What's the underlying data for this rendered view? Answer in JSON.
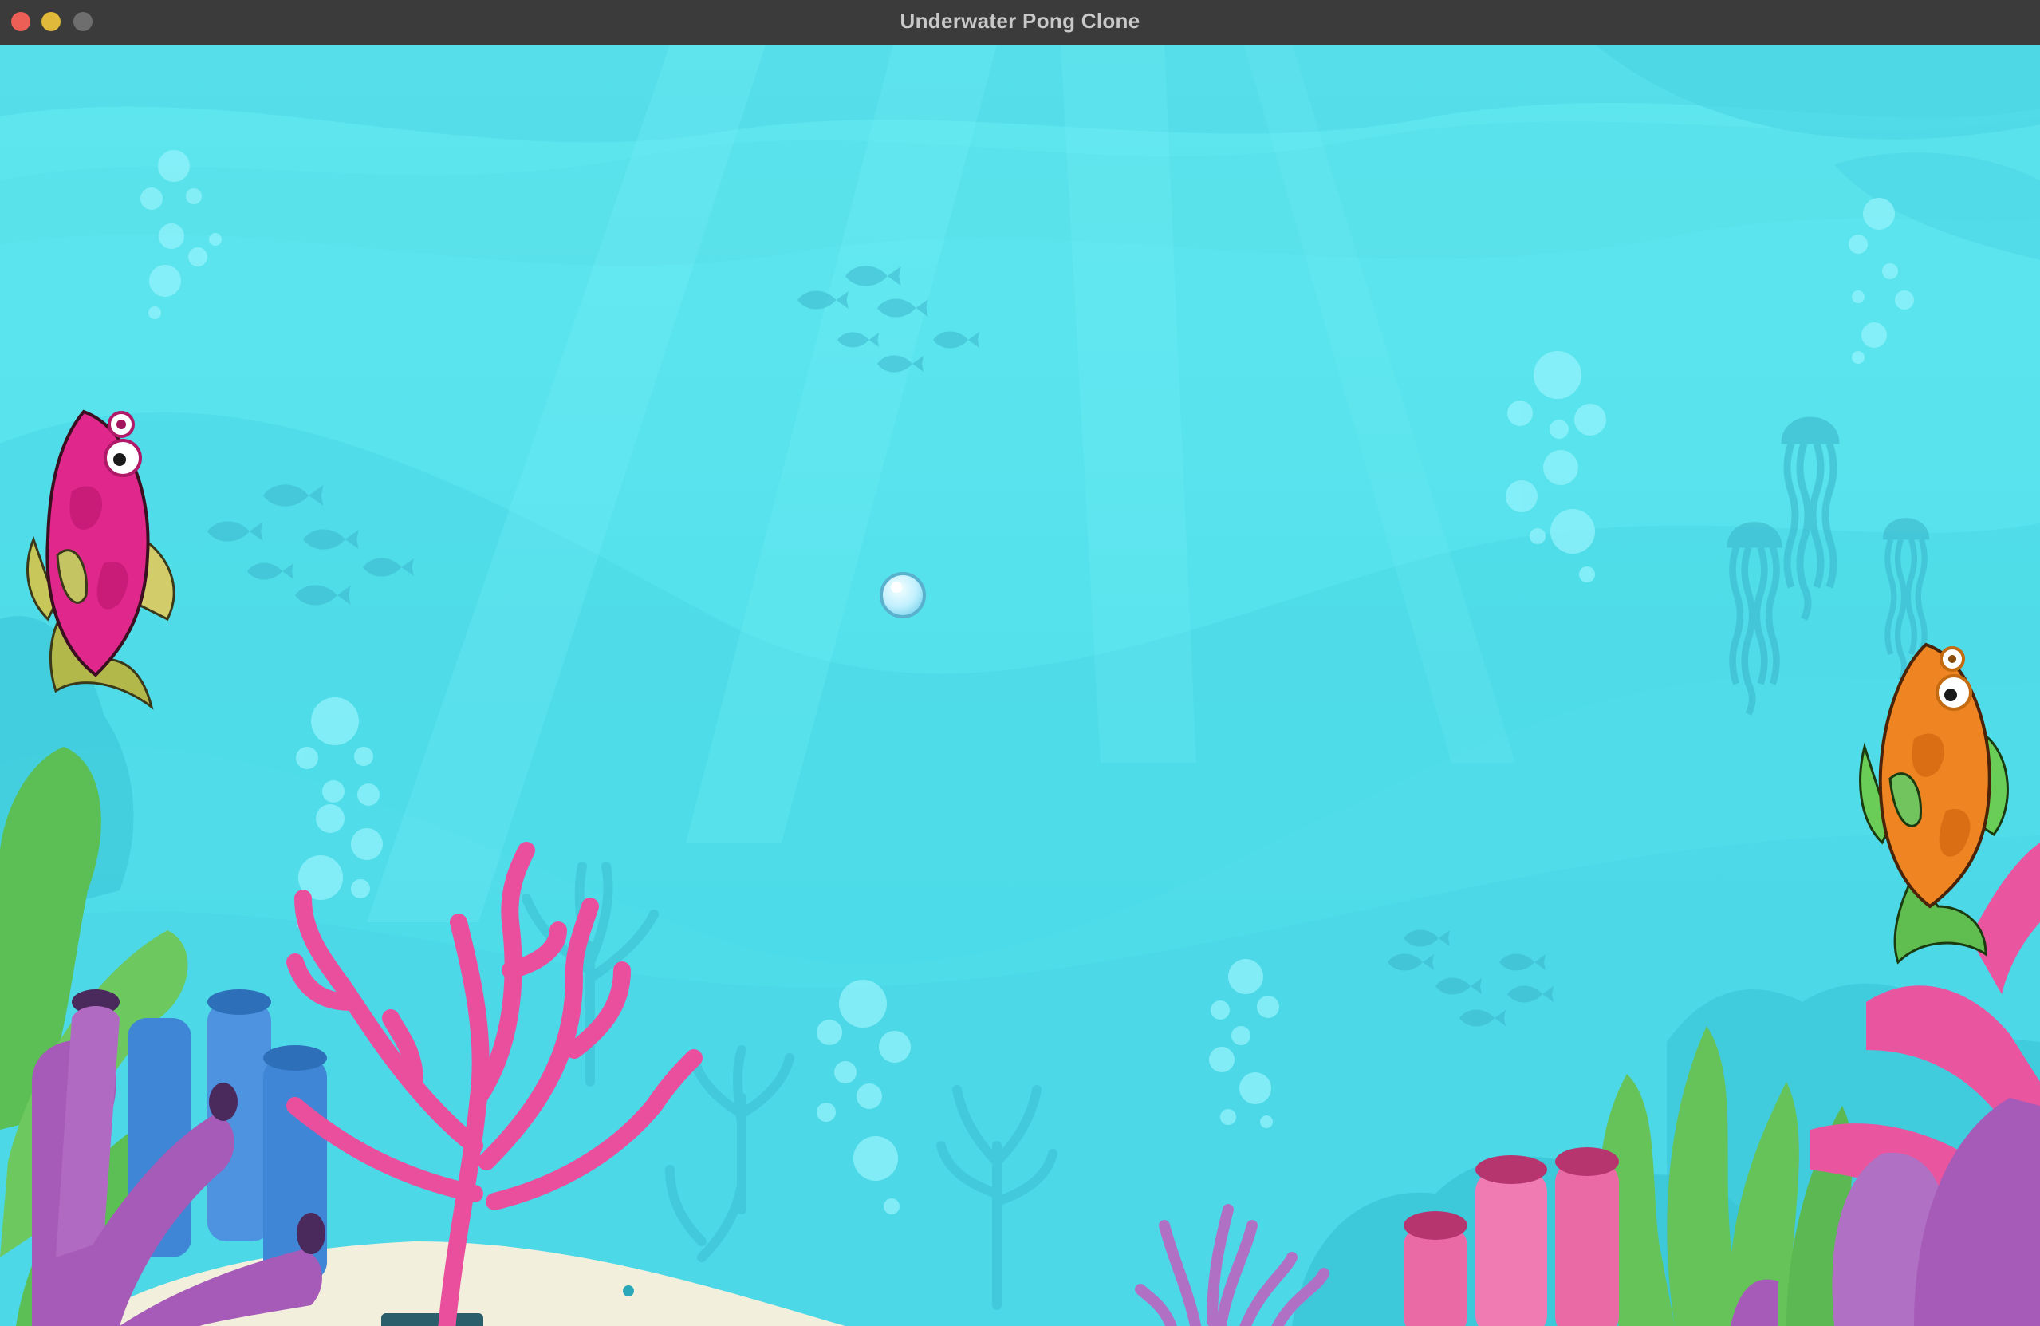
{
  "window": {
    "title": "Underwater Pong Clone",
    "controls": [
      {
        "name": "close",
        "color": "#ec5f57"
      },
      {
        "name": "minimize",
        "color": "#e0b83a"
      },
      {
        "name": "zoom",
        "color": "#6e6e6e"
      }
    ]
  },
  "game": {
    "theme_colors": {
      "water_top": "#5fe6ef",
      "water_bottom": "#3fd6e6",
      "left_paddle": "#e0278c",
      "right_paddle": "#ee8422",
      "ball": "#d9f6ff"
    },
    "left_paddle": {
      "sprite": "pink-fish-icon"
    },
    "right_paddle": {
      "sprite": "orange-fish-icon"
    },
    "ball": {
      "sprite": "bubble-icon"
    }
  }
}
